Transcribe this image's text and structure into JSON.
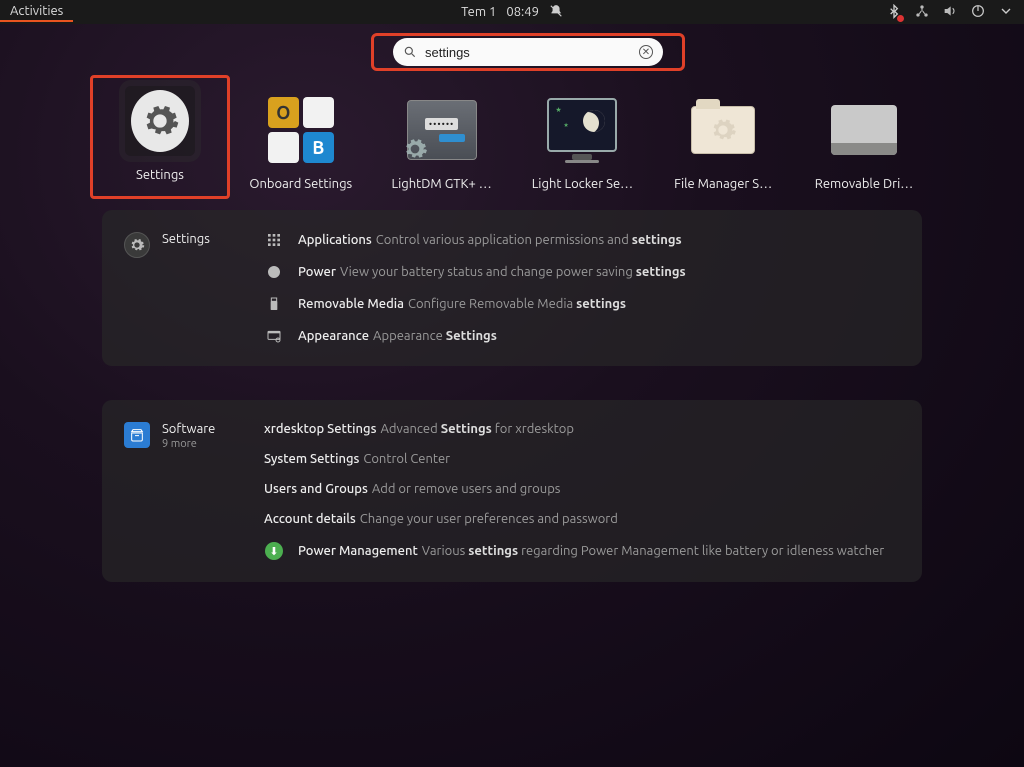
{
  "topbar": {
    "activities": "Activities",
    "date": "Tem 1",
    "time": "08:49"
  },
  "search": {
    "value": "settings"
  },
  "apps": [
    {
      "label": "Settings"
    },
    {
      "label": "Onboard Settings"
    },
    {
      "label": "LightDM GTK+ …"
    },
    {
      "label": "Light Locker Se…"
    },
    {
      "label": "File Manager S…"
    },
    {
      "label": "Removable Dri…"
    }
  ],
  "settings_panel": {
    "header": "Settings",
    "items": [
      {
        "title": "Applications",
        "desc_pre": "Control various application permissions and ",
        "desc_hl": "settings"
      },
      {
        "title": "Power",
        "desc_pre": "View your battery status and change power saving ",
        "desc_hl": "settings"
      },
      {
        "title": "Removable Media",
        "desc_pre": "Configure Removable Media ",
        "desc_hl": "settings"
      },
      {
        "title": "Appearance",
        "desc_pre": "Appearance ",
        "desc_hl": "Settings"
      }
    ]
  },
  "software_panel": {
    "header": "Software",
    "sub": "9 more",
    "items": [
      {
        "title": "xrdesktop Settings",
        "desc_pre": "Advanced ",
        "desc_hl": "Settings",
        "desc_post": " for xrdesktop"
      },
      {
        "title": "System Settings",
        "desc_pre": "Control Center",
        "desc_hl": "",
        "desc_post": ""
      },
      {
        "title": "Users and Groups",
        "desc_pre": "Add or remove users and groups",
        "desc_hl": "",
        "desc_post": ""
      },
      {
        "title": "Account details",
        "desc_pre": "Change your user preferences and password",
        "desc_hl": "",
        "desc_post": ""
      },
      {
        "title": "Power Management",
        "desc_pre": "Various ",
        "desc_hl": "settings",
        "desc_post": " regarding Power Management like battery or idleness watcher"
      }
    ]
  }
}
